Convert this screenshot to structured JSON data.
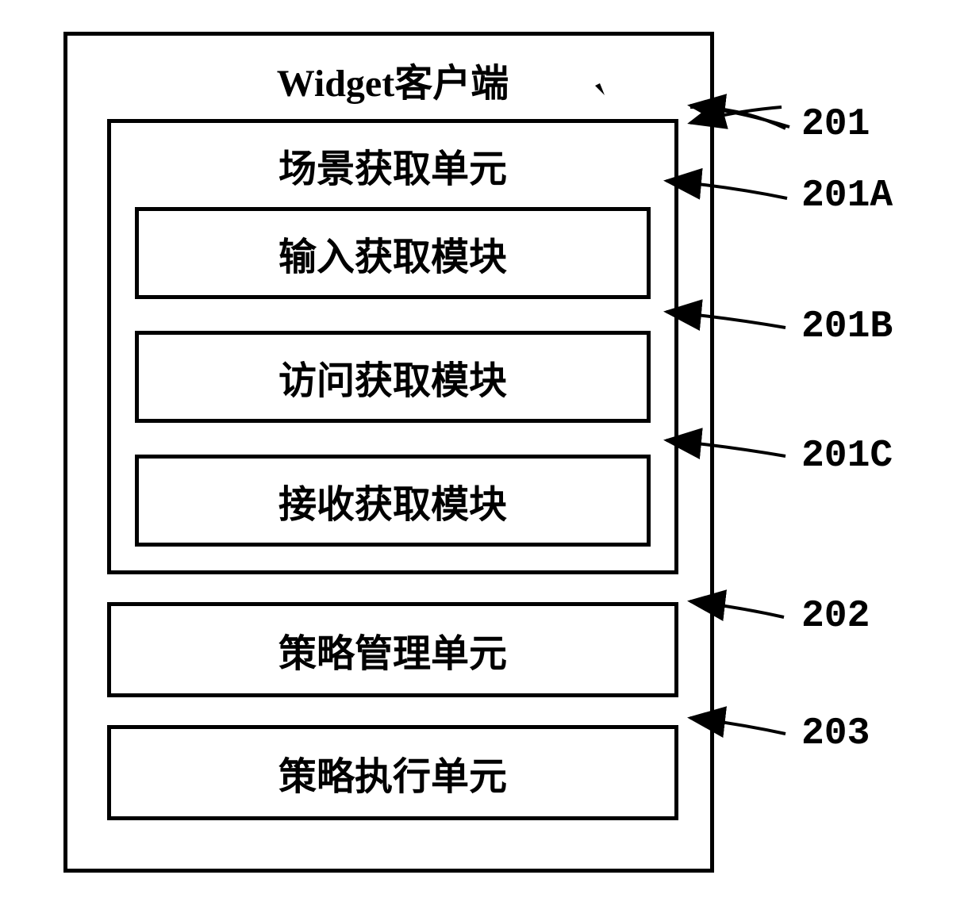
{
  "diagram": {
    "title": "Widget客户端",
    "scene_unit": {
      "title": "场景获取单元",
      "callout": "201",
      "modules": [
        {
          "label": "输入获取模块",
          "callout": "201A"
        },
        {
          "label": "访问获取模块",
          "callout": "201B"
        },
        {
          "label": "接收获取模块",
          "callout": "201C"
        }
      ]
    },
    "policy_mgmt": {
      "label": "策略管理单元",
      "callout": "202"
    },
    "policy_exec": {
      "label": "策略执行单元",
      "callout": "203"
    }
  }
}
